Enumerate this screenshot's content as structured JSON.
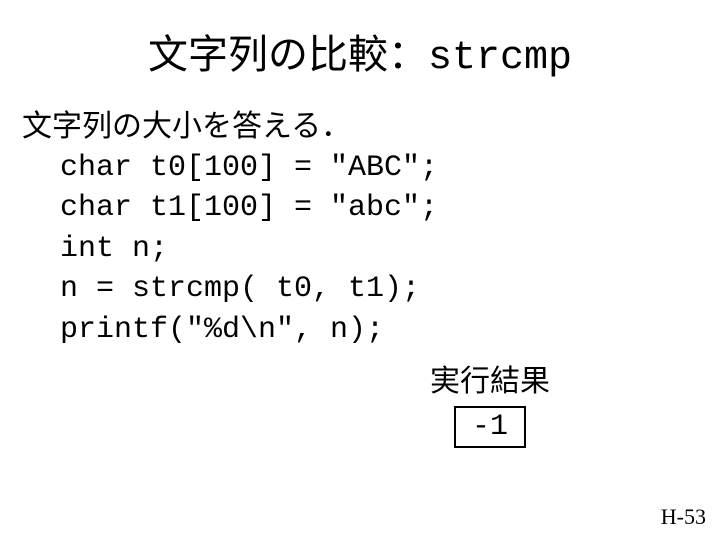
{
  "title": {
    "jp": "文字列の比較：",
    "fn": "strcmp"
  },
  "intro": "文字列の大小を答える．",
  "code": {
    "l1": "char t0[100] = \"ABC\";",
    "l2": "char t1[100] = \"abc\";",
    "l3": "int n;",
    "l4": "n = strcmp( t0, t1);",
    "l5": "printf(\"%d\\n\", n);"
  },
  "result": {
    "label": "実行結果",
    "value": "-1"
  },
  "page": "H-53"
}
